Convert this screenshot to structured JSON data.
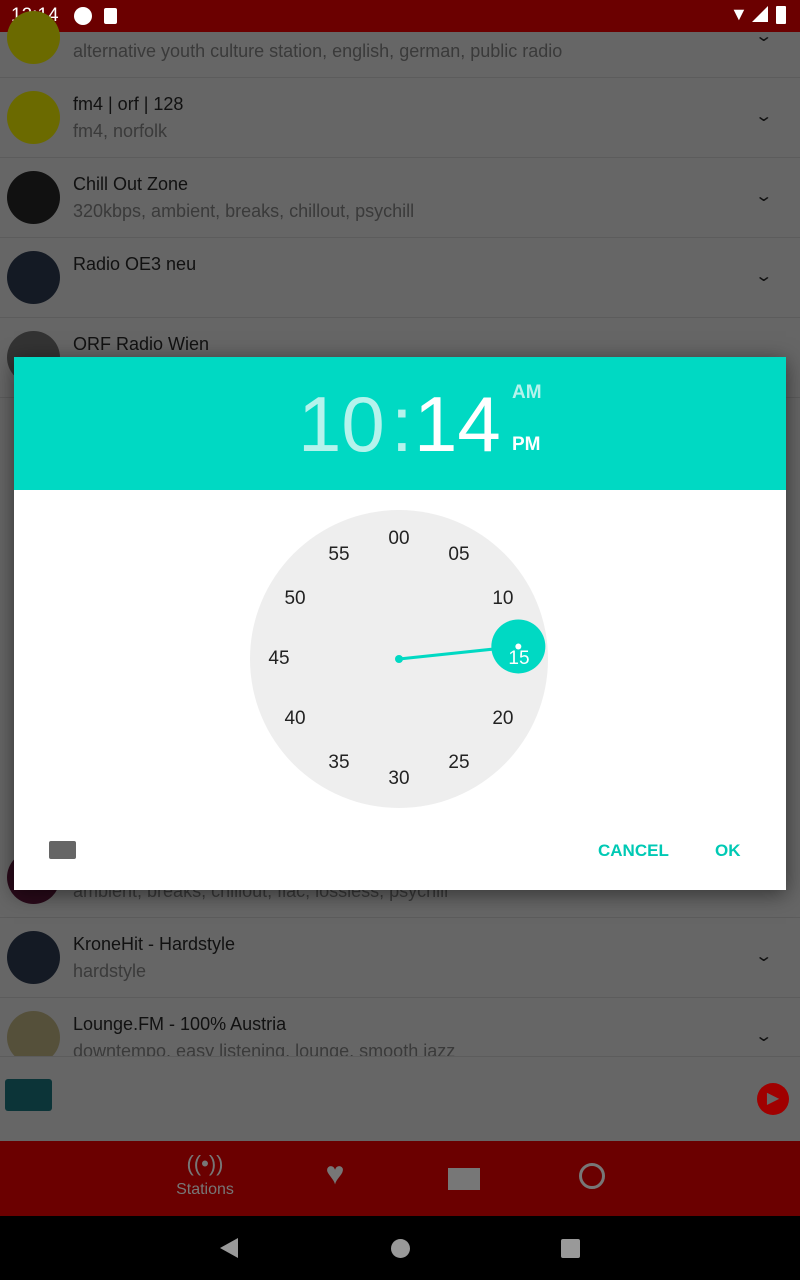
{
  "status_bar": {
    "time": "12:14"
  },
  "stations": [
    {
      "title": "",
      "subtitle": "alternative youth culture station, english, german, public radio",
      "logo_color": "#6b6a00"
    },
    {
      "title": "fm4 | orf | 128",
      "subtitle": "fm4, norfolk",
      "logo_color": "#6b6a00"
    },
    {
      "title": "Chill Out Zone",
      "subtitle": "320kbps, ambient, breaks, chillout, psychill",
      "logo_color": "#111"
    },
    {
      "title": "Radio OE3 neu",
      "subtitle": "",
      "logo_color": "#141a24"
    },
    {
      "title": "ORF Radio Wien",
      "subtitle": "",
      "logo_color": "#333"
    },
    {
      "title": "",
      "subtitle": "ambient, breaks, chillout, flac, lossless, psychill",
      "logo_color": "#2a0a1a"
    },
    {
      "title": "KroneHit - Hardstyle",
      "subtitle": "hardstyle",
      "logo_color": "#141a24"
    },
    {
      "title": "Lounge.FM - 100% Austria",
      "subtitle": "downtempo, easy listening, lounge, smooth jazz",
      "logo_color": "#55503a"
    }
  ],
  "time_picker": {
    "hour": "10",
    "separator": ":",
    "minute": "14",
    "am": "AM",
    "pm": "PM",
    "selected_period": "PM",
    "minute_labels": [
      "00",
      "05",
      "10",
      "15",
      "20",
      "25",
      "30",
      "35",
      "40",
      "45",
      "50",
      "55"
    ],
    "selected_minute": 14,
    "cancel": "CANCEL",
    "ok": "OK",
    "accent": "#00d9c3"
  },
  "bottom_nav": {
    "stations": "Stations"
  }
}
